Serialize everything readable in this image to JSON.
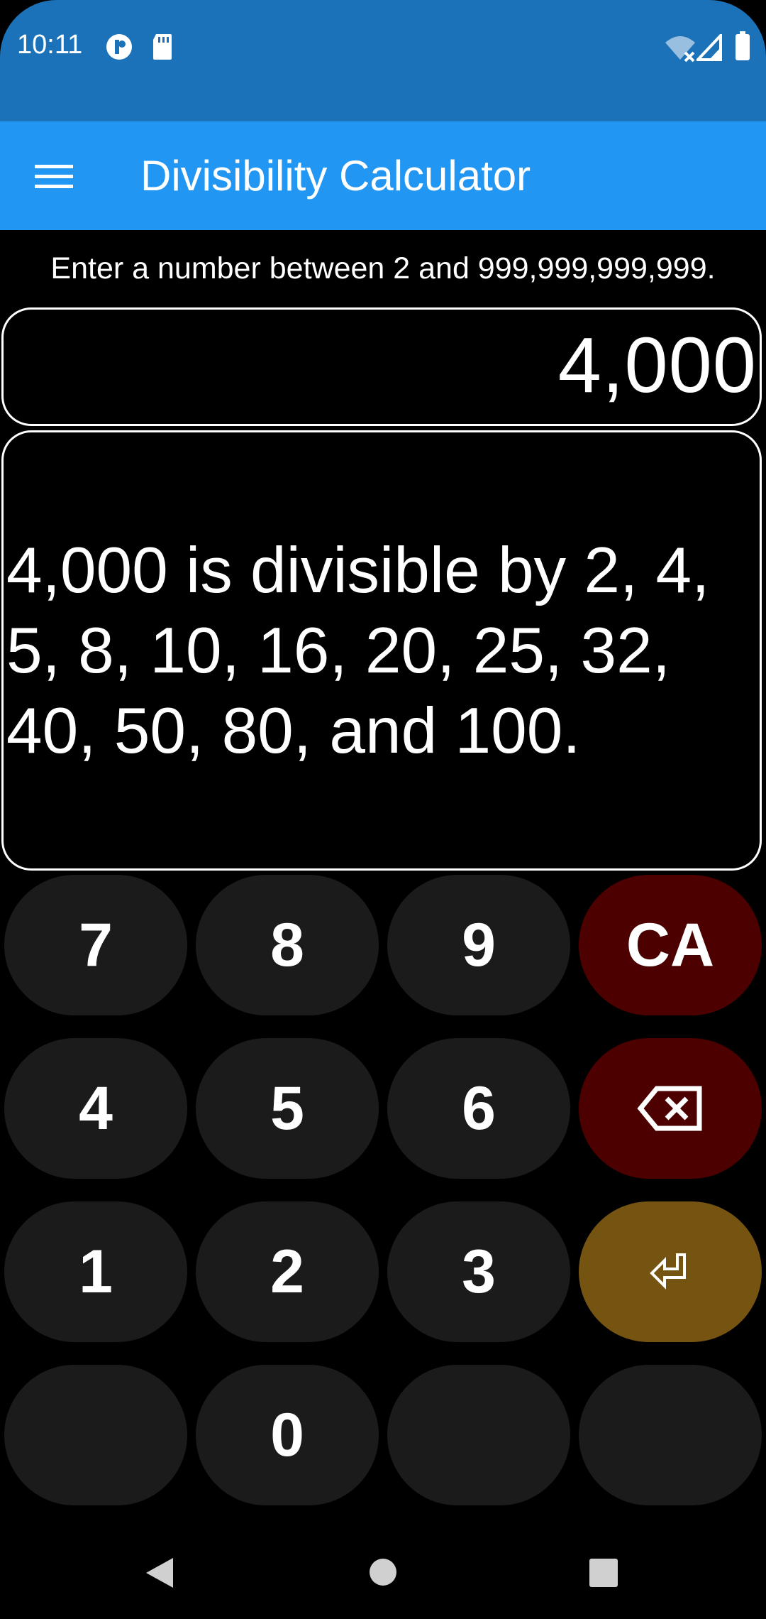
{
  "status_bar": {
    "time": "10:11",
    "icons": [
      "data-saver-icon",
      "sd-card-icon",
      "wifi-off-icon",
      "signal-icon",
      "battery-icon"
    ]
  },
  "app_bar": {
    "title": "Divisibility Calculator",
    "menu_icon": "hamburger-menu-icon"
  },
  "instruction": "Enter a number between 2 and 999,999,999,999.",
  "input": {
    "value": "4,000"
  },
  "result": {
    "text": "4,000 is divisible by 2, 4, 5, 8, 10, 16, 20, 25, 32, 40, 50, 80, and 100."
  },
  "keypad": {
    "seven": "7",
    "eight": "8",
    "nine": "9",
    "clear_all": "CA",
    "four": "4",
    "five": "5",
    "six": "6",
    "backspace_icon": "backspace-icon",
    "one": "1",
    "two": "2",
    "three": "3",
    "enter_icon": "enter-icon",
    "zero": "0"
  },
  "colors": {
    "status_bar": "#1c72b8",
    "app_bar": "#2196f3",
    "key_default": "#1b1b1b",
    "key_red": "#4c0000",
    "key_amber": "#745410"
  },
  "nav_bar": {
    "icons": [
      "back-icon",
      "home-icon",
      "recents-icon"
    ]
  }
}
